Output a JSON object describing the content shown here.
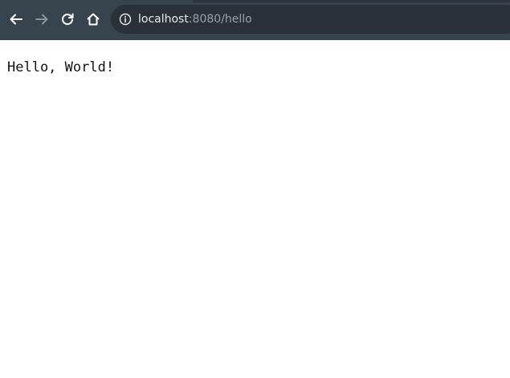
{
  "browser": {
    "address_bar": {
      "host": "localhost",
      "path": ":8080/hello"
    },
    "icons": {
      "back": "arrow-left-icon",
      "forward": "arrow-right-icon",
      "reload": "reload-icon",
      "home": "home-icon",
      "site_info": "info-icon"
    },
    "colors": {
      "toolbar": "#37434d",
      "omnibox": "#2a3138",
      "icon_active": "#ffffff",
      "icon_disabled": "#8a949c",
      "url_host": "#e8eaed",
      "url_rest": "#9aa0a6"
    }
  },
  "page": {
    "body_text": "Hello, World!"
  }
}
